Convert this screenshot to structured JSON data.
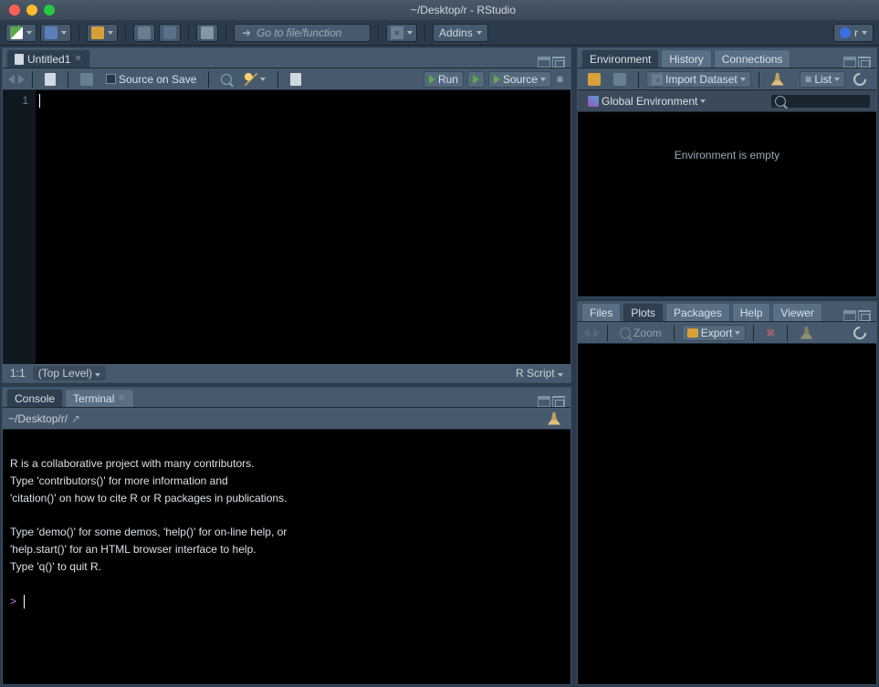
{
  "titlebar": {
    "title": "~/Desktop/r - RStudio"
  },
  "maintb": {
    "fileinput_placeholder": "Go to file/function",
    "addins_label": "Addins",
    "project_label": "r"
  },
  "source": {
    "tab_label": "Untitled1",
    "source_on_save": "Source on Save",
    "run_label": "Run",
    "source_label": "Source",
    "line_number": "1",
    "status_pos": "1:1",
    "status_scope": "(Top Level)",
    "status_lang": "R Script"
  },
  "console_pane": {
    "tab_console": "Console",
    "tab_terminal": "Terminal",
    "wd": "~/Desktop/r/",
    "body_text": "\nR is a collaborative project with many contributors.\nType 'contributors()' for more information and\n'citation()' on how to cite R or R packages in publications.\n\nType 'demo()' for some demos, 'help()' for on-line help, or\n'help.start()' for an HTML browser interface to help.\nType 'q()' to quit R.\n",
    "prompt": ">"
  },
  "env_pane": {
    "tabs": {
      "environment": "Environment",
      "history": "History",
      "connections": "Connections"
    },
    "import_label": "Import Dataset",
    "list_label": "List",
    "scope_label": "Global Environment",
    "empty_msg": "Environment is empty"
  },
  "plots_pane": {
    "tabs": {
      "files": "Files",
      "plots": "Plots",
      "packages": "Packages",
      "help": "Help",
      "viewer": "Viewer"
    },
    "zoom_label": "Zoom",
    "export_label": "Export"
  }
}
